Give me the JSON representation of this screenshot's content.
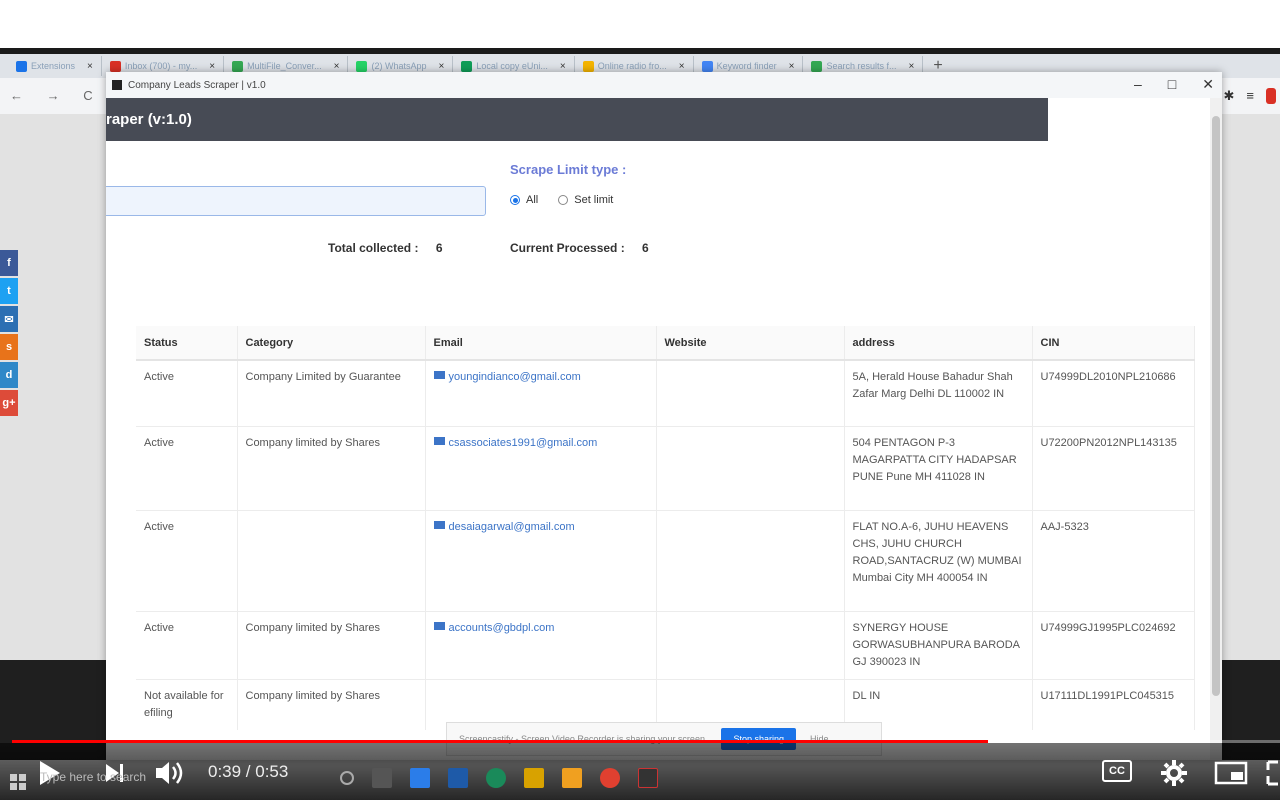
{
  "browser": {
    "tabs": [
      {
        "label": "Extensions",
        "color": "#1a73e8"
      },
      {
        "label": "Inbox (700) - my...",
        "color": "#d93025"
      },
      {
        "label": "MultiFile_Conver...",
        "color": "#34a853"
      },
      {
        "label": "(2) WhatsApp",
        "color": "#25d366"
      },
      {
        "label": "Local copy eUni...",
        "color": "#0f9d58"
      },
      {
        "label": "Online radio fro...",
        "color": "#f4b400"
      },
      {
        "label": "Keyword finder",
        "color": "#4285f4"
      },
      {
        "label": "Search results f...",
        "color": "#34a853"
      }
    ],
    "tab_close": "×",
    "tab_plus": "+",
    "nav": "← → C"
  },
  "window": {
    "title": "Company Leads Scraper | v1.0",
    "controls": [
      "–",
      "□",
      "✕"
    ]
  },
  "app": {
    "header": "raper (v:1.0)",
    "scrape_limit_label": "Scrape Limit type :",
    "radio_all": "All",
    "radio_set_limit": "Set limit",
    "total_collected_label": "Total collected :",
    "total_collected_value": "6",
    "current_processed_label": "Current Processed :",
    "current_processed_value": "6"
  },
  "table": {
    "headers": [
      "Status",
      "Category",
      "Email",
      "Website",
      "address",
      "CIN"
    ],
    "rows": [
      {
        "status": "Active",
        "category": "Company Limited by Guarantee",
        "email": "youngindianco@gmail.com",
        "website": "",
        "address": "5A, Herald House Bahadur Shah Zafar Marg Delhi DL 110002 IN",
        "cin": "U74999DL2010NPL210686"
      },
      {
        "status": "Active",
        "category": "Company limited by Shares",
        "email": "csassociates1991@gmail.com",
        "website": "",
        "address": "504 PENTAGON P-3 MAGARPATTA CITY HADAPSAR PUNE Pune MH 411028 IN",
        "cin": "U72200PN2012NPL143135"
      },
      {
        "status": "Active",
        "category": "",
        "email": "desaiagarwal@gmail.com",
        "website": "",
        "address": "FLAT NO.A-6, JUHU HEAVENS CHS, JUHU CHURCH ROAD,SANTACRUZ (W) MUMBAI Mumbai City MH 400054 IN",
        "cin": "AAJ-5323"
      },
      {
        "status": "Active",
        "category": "Company limited by Shares",
        "email": "accounts@gbdpl.com",
        "website": "",
        "address": "SYNERGY HOUSE GORWASUBHANPURA BARODA GJ 390023 IN",
        "cin": "U74999GJ1995PLC024692"
      },
      {
        "status": "Not available for efiling",
        "category": "Company limited by Shares",
        "email": "",
        "website": "",
        "address": "DL IN",
        "cin": "U17111DL1991PLC045315"
      }
    ]
  },
  "toast": {
    "text": "Screencastify - Screen Video Recorder is sharing your screen.",
    "button": "Stop sharing",
    "hide": "Hide"
  },
  "player": {
    "time": "0:39 / 0:53",
    "progress": 0.766,
    "cc": "CC"
  },
  "taskbar": {
    "search_placeholder": "Type here to search"
  },
  "share_buttons": [
    {
      "label": "f",
      "color": "#3b5998"
    },
    {
      "label": "t",
      "color": "#1da1f2"
    },
    {
      "label": "✉",
      "color": "#2c6fb3"
    },
    {
      "label": "s",
      "color": "#e8731a"
    },
    {
      "label": "d",
      "color": "#2f88c8"
    },
    {
      "label": "g+",
      "color": "#dd4b39"
    }
  ]
}
